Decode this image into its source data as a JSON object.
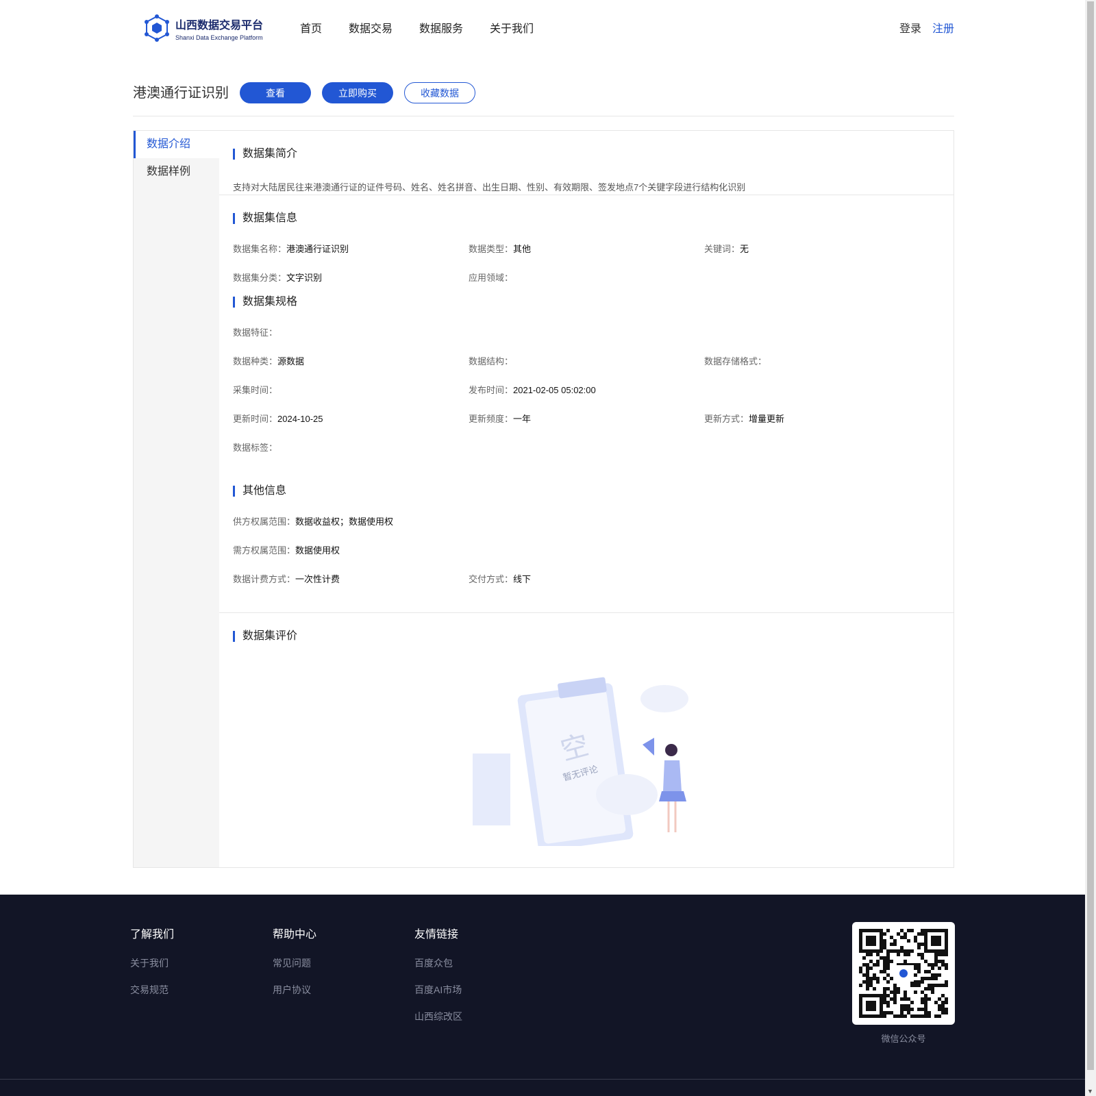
{
  "header": {
    "logo_title": "山西数据交易平台",
    "logo_subtitle": "Shanxi Data Exchange Platform",
    "nav": [
      "首页",
      "数据交易",
      "数据服务",
      "关于我们"
    ],
    "login": "登录",
    "register": "注册"
  },
  "product": {
    "title": "港澳通行证识别",
    "view": "查看",
    "buy": "立即购买",
    "favorite": "收藏数据"
  },
  "sidebar": [
    "数据介绍",
    "数据样例"
  ],
  "intro": {
    "heading": "数据集简介",
    "text": "支持对大陆居民往来港澳通行证的证件号码、姓名、姓名拼音、出生日期、性别、有效期限、签发地点7个关键字段进行结构化识别"
  },
  "info": {
    "heading": "数据集信息",
    "rows": [
      [
        {
          "label": "数据集名称：",
          "value": "港澳通行证识别"
        },
        {
          "label": "数据类型：",
          "value": "其他"
        },
        {
          "label": "关键词：",
          "value": "无"
        }
      ],
      [
        {
          "label": "数据集分类：",
          "value": "文字识别"
        },
        {
          "label": "应用领域：",
          "value": ""
        }
      ]
    ]
  },
  "spec": {
    "heading": "数据集规格",
    "rows": [
      [
        {
          "label": "数据特征：",
          "value": ""
        }
      ],
      [
        {
          "label": "数据种类：",
          "value": "源数据"
        },
        {
          "label": "数据结构：",
          "value": ""
        },
        {
          "label": "数据存储格式：",
          "value": ""
        }
      ],
      [
        {
          "label": "采集时间：",
          "value": ""
        },
        {
          "label": "发布时间：",
          "value": "2021-02-05 05:02:00"
        }
      ],
      [
        {
          "label": "更新时间：",
          "value": "2024-10-25"
        },
        {
          "label": "更新频度：",
          "value": "一年"
        },
        {
          "label": "更新方式：",
          "value": "增量更新"
        }
      ],
      [
        {
          "label": "数据标签：",
          "value": ""
        }
      ]
    ]
  },
  "other": {
    "heading": "其他信息",
    "rows": [
      [
        {
          "label": "供方权属范围：",
          "value": "数据收益权；数据使用权"
        }
      ],
      [
        {
          "label": "需方权属范围：",
          "value": "数据使用权"
        }
      ],
      [
        {
          "label": "数据计费方式：",
          "value": "一次性计费"
        },
        {
          "label": "交付方式：",
          "value": "线下"
        }
      ]
    ]
  },
  "review": {
    "heading": "数据集评价",
    "empty_big": "空",
    "empty_text": "暂无评论"
  },
  "footer": {
    "cols": [
      {
        "title": "了解我们",
        "links": [
          "关于我们",
          "交易规范"
        ]
      },
      {
        "title": "帮助中心",
        "links": [
          "常见问题",
          "用户协议"
        ]
      },
      {
        "title": "友情链接",
        "links": [
          "百度众包",
          "百度AI市场",
          "山西综改区"
        ]
      }
    ],
    "qr_caption": "微信公众号"
  }
}
